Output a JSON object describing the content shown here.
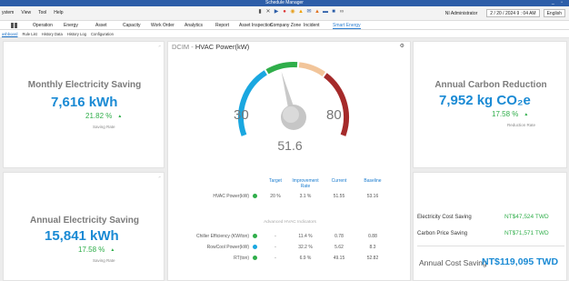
{
  "window": {
    "title": "Schedule Manager",
    "controls": "_ ▫"
  },
  "menu": {
    "items": [
      "ystem",
      "View",
      "Tool",
      "Help"
    ]
  },
  "toolbar_icons": [
    {
      "name": "mic-icon",
      "glyph": "▮",
      "color": "#555"
    },
    {
      "name": "shuffle-icon",
      "glyph": "✕",
      "color": "#555"
    },
    {
      "name": "play-icon",
      "glyph": "▶",
      "color": "#2d5ea8"
    },
    {
      "name": "record-icon",
      "glyph": "●",
      "color": "#d33"
    },
    {
      "name": "signal-icon",
      "glyph": "◉",
      "color": "#e6a020"
    },
    {
      "name": "warning-icon",
      "glyph": "▲",
      "color": "#f0a000"
    },
    {
      "name": "mail-icon",
      "glyph": "✉",
      "color": "#2d5ea8"
    },
    {
      "name": "alert-icon",
      "glyph": "▲",
      "color": "#e07020"
    },
    {
      "name": "chat-icon",
      "glyph": "▬",
      "color": "#2d5ea8"
    },
    {
      "name": "info-icon",
      "glyph": "■",
      "color": "#2d5ea8"
    },
    {
      "name": "link-icon",
      "glyph": "∞",
      "color": "#555"
    }
  ],
  "user": {
    "name": "NI Administrator",
    "datetime": "2 / 20 / 2024  9 : 04   AM",
    "language": "English"
  },
  "nav": {
    "items": [
      {
        "label": "Operation",
        "active": false
      },
      {
        "label": "Energy",
        "active": false
      },
      {
        "label": "Asset",
        "active": false
      },
      {
        "label": "Capacity",
        "active": false
      },
      {
        "label": "Work Order",
        "active": false
      },
      {
        "label": "Analytics",
        "active": false
      },
      {
        "label": "Report",
        "active": false
      },
      {
        "label": "Asset Inspection",
        "active": false
      },
      {
        "label": "Company Zone",
        "active": false
      },
      {
        "label": "Incident",
        "active": false
      },
      {
        "label": "Smart Energy",
        "active": true
      }
    ]
  },
  "subtabs": [
    "ashboard",
    "Rule List",
    "History Data",
    "History Log",
    "Configuration"
  ],
  "monthly_saving": {
    "title": "Monthly Electricity Saving",
    "value": "7,616 kWh",
    "rate": "21.82 %",
    "rate_label": "Saving Rate"
  },
  "annual_saving": {
    "title": "Annual Electricity Saving",
    "value": "15,841 kWh",
    "rate": "17.58 %",
    "rate_label": "Saving Rate"
  },
  "carbon": {
    "title": "Annual Carbon Reduction",
    "value": "7,952  kg CO₂e",
    "rate": "17.58 %",
    "rate_label": "Reduction Rate"
  },
  "center": {
    "crumb": "DCIM",
    "sep": " - ",
    "title": "HVAC Power(kW)",
    "gauge": {
      "min_label": "30",
      "max_label": "80",
      "value_label": "51.6",
      "min": 30,
      "max": 80,
      "value": 51.6
    },
    "headers": {
      "target": "Target",
      "improvement": "Improvement Rate",
      "current": "Current",
      "baseline": "Baseline"
    },
    "main_row": {
      "label": "HVAC Power(kW)",
      "target": "20 %",
      "improvement": "3.1 %",
      "current": "51.55",
      "baseline": "53.16",
      "dot": "#2fae4a"
    },
    "advanced_label": "Advanced HVAC Indicators",
    "adv_rows": [
      {
        "label": "Chiller Efficiency (KW/ton)",
        "target": "-",
        "improvement": "11.4 %",
        "current": "0.78",
        "baseline": "0.88",
        "dot": "#2fae4a"
      },
      {
        "label": "RowCool Power(kW)",
        "target": "-",
        "improvement": "32.2 %",
        "current": "5.62",
        "baseline": "8.3",
        "dot": "#1aa7e0"
      },
      {
        "label": "RT(ton)",
        "target": "-",
        "improvement": "6.9 %",
        "current": "49.15",
        "baseline": "52.82",
        "dot": "#2fae4a"
      }
    ]
  },
  "cost": {
    "electricity_label": "Electricity Cost Saving",
    "electricity_value": "NT$47,524 TWD",
    "carbon_label": "Carbon Price Saving",
    "carbon_value": "NT$71,571 TWD",
    "total_label": "Annual Cost Saving",
    "total_value": "NT$119,095 TWD"
  }
}
